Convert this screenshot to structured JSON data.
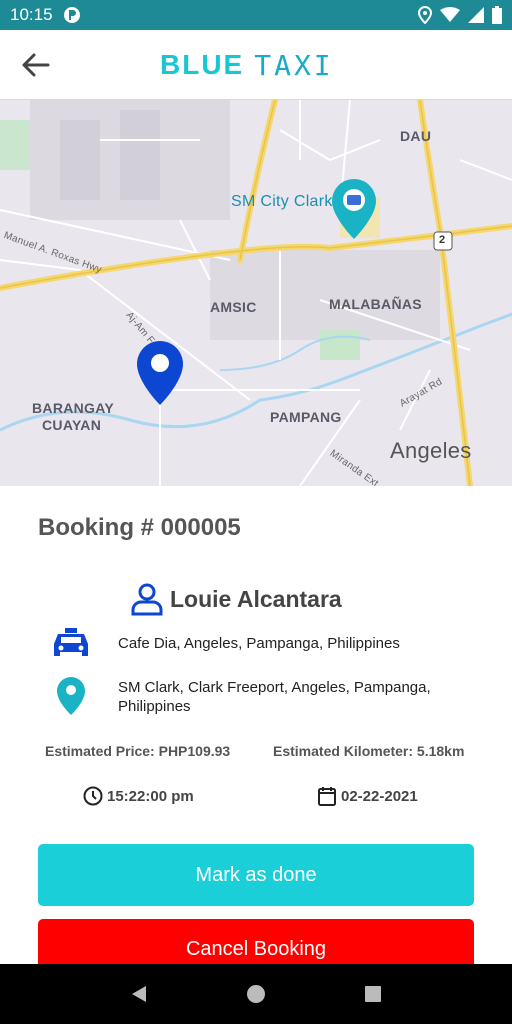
{
  "status_bar": {
    "time": "10:15",
    "icons": [
      "app-notification-icon",
      "location-icon",
      "wifi-icon",
      "signal-icon",
      "battery-icon"
    ]
  },
  "header": {
    "logo_bold": "BLUE",
    "logo_light": "TAXI",
    "back_icon": "arrow-left-icon"
  },
  "map": {
    "labels": {
      "dau": "DAU",
      "sm_city_clark": "SM City Clark",
      "road_2": "2",
      "roxas_hwy": "Manuel A. Roxas Hwy",
      "amsic": "AMSIC",
      "malabanas": "MALABAÑAS",
      "barangay_cuayan_1": "BARANGAY",
      "barangay_cuayan_2": "CUAYAN",
      "pampang": "PAMPANG",
      "angeles": "Angeles",
      "arayat_rd": "Arayat Rd",
      "miranda_ext": "Miranda Ext",
      "aram_road": "Aj-Am Fre"
    }
  },
  "booking": {
    "title": "Booking # 000005",
    "passenger_name": "Louie Alcantara",
    "pickup": "Cafe Dia, Angeles, Pampanga, Philippines",
    "dropoff": "SM Clark, Clark Freeport, Angeles, Pampanga, Philippines",
    "estimated_price": "Estimated Price: PHP109.93",
    "estimated_km": "Estimated Kilometer: 5.18km",
    "time": "15:22:00 pm",
    "date": "02-22-2021"
  },
  "actions": {
    "mark_done": "Mark as done",
    "cancel": "Cancel Booking"
  },
  "colors": {
    "status_bar": "#1e8a95",
    "accent": "#1acfd8",
    "danger": "#ff0000",
    "pin_blue": "#0d47d1",
    "pin_teal": "#1ab3c6"
  }
}
